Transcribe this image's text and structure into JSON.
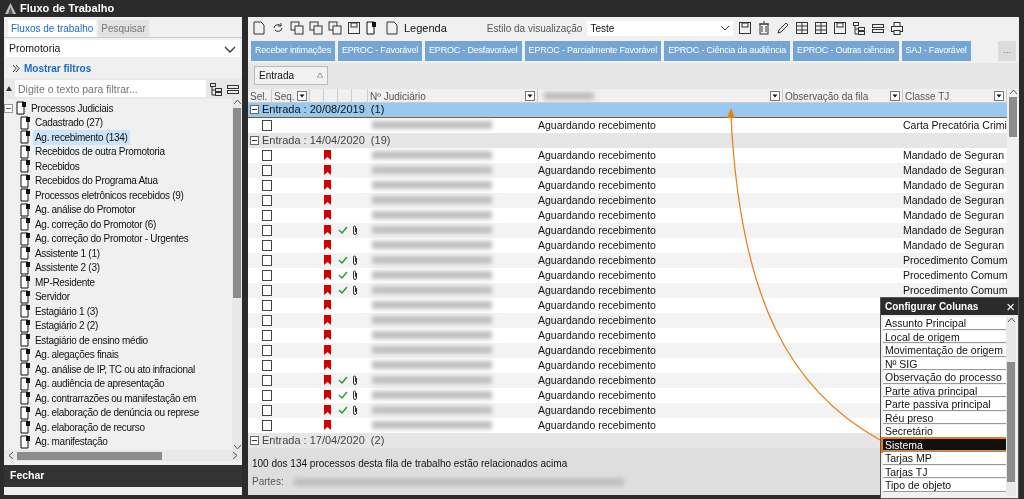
{
  "window": {
    "title": "Fluxo de Trabalho"
  },
  "sidebar": {
    "tabs": [
      {
        "label": "Fluxos de trabalho",
        "selected": true
      },
      {
        "label": "Pesquisar",
        "selected": false
      }
    ],
    "dropdown": {
      "value": "Promotoria"
    },
    "filters_link": "Mostrar filtros",
    "filter": {
      "placeholder": "Digite o texto para filtrar..."
    },
    "tree": [
      {
        "label": "Processos Judiciais",
        "expanded": true,
        "selected": false,
        "children": [
          {
            "label": "Cadastrado (27)",
            "selected": false
          },
          {
            "label": "Ag. recebimento (134)",
            "selected": true
          },
          {
            "label": "Recebidos de outra Promotoria",
            "selected": false
          },
          {
            "label": "Recebidos",
            "selected": false
          },
          {
            "label": "Recebidos do Programa Atua",
            "selected": false
          },
          {
            "label": "Processos eletrônicos recebidos (9)",
            "selected": false
          },
          {
            "label": "Ag. análise do Promotor",
            "selected": false
          },
          {
            "label": "Ag. correção do Promotor (6)",
            "selected": false
          },
          {
            "label": "Ag. correção do Promotor - Urgentes",
            "selected": false
          },
          {
            "label": "Assistente 1 (1)",
            "selected": false
          },
          {
            "label": "Assistente 2 (3)",
            "selected": false
          },
          {
            "label": "MP-Residente",
            "selected": false
          },
          {
            "label": "Servidor",
            "selected": false
          },
          {
            "label": "Estagiário 1 (3)",
            "selected": false
          },
          {
            "label": "Estagiário 2 (2)",
            "selected": false
          },
          {
            "label": "Estagiário de ensino médio",
            "selected": false
          },
          {
            "label": "Ag. alegações finais",
            "selected": false
          },
          {
            "label": "Ag. análise de IP, TC ou ato infracional",
            "selected": false
          },
          {
            "label": "Ag. audiência de apresentação",
            "selected": false
          },
          {
            "label": "Ag. contrarrazões ou manifestação em",
            "selected": false
          },
          {
            "label": "Ag. elaboração de denúncia ou represe",
            "selected": false
          },
          {
            "label": "Ag. elaboração de recurso",
            "selected": false
          },
          {
            "label": "Ag. manifestação",
            "selected": false
          }
        ]
      }
    ],
    "close_button": "Fechar"
  },
  "toolbar": {
    "legend": "Legenda",
    "view_style_label": "Estilo da visualização",
    "view_style": "Teste"
  },
  "action_buttons": [
    "Receber intimações",
    "EPROC - Favorável",
    "EPROC - Desfavorável",
    "EPROC - Parcialmente Favorável",
    "EPROC - Ciência da audiência",
    "EPROC - Outras ciências",
    "SAJ - Favorável"
  ],
  "more_button": "...",
  "group_by": {
    "label": "Entrada"
  },
  "table": {
    "columns": [
      "Sel.",
      "Seq.",
      "",
      "",
      "",
      "",
      "Nº Judiciário",
      "",
      "Observação da fila",
      "Classe TJ"
    ],
    "groups": [
      {
        "label": "Entrada : 20/08/2019",
        "count": "(1)",
        "expanded": true,
        "selected": true,
        "rows": [
          {
            "checked": false,
            "flag": false,
            "done": false,
            "attachment": false,
            "status": "Aguardando recebimento",
            "classe": "Carta Precatória Crimi"
          }
        ]
      },
      {
        "label": "Entrada : 14/04/2020",
        "count": "(19)",
        "expanded": true,
        "selected": false,
        "rows": [
          {
            "checked": false,
            "flag": true,
            "done": false,
            "attachment": false,
            "status": "Aguardando recebimento",
            "classe": "Mandado de Seguran"
          },
          {
            "checked": false,
            "flag": true,
            "done": false,
            "attachment": false,
            "status": "Aguardando recebimento",
            "classe": "Mandado de Seguran"
          },
          {
            "checked": false,
            "flag": true,
            "done": false,
            "attachment": false,
            "status": "Aguardando recebimento",
            "classe": "Mandado de Seguran"
          },
          {
            "checked": false,
            "flag": true,
            "done": false,
            "attachment": false,
            "status": "Aguardando recebimento",
            "classe": "Mandado de Seguran"
          },
          {
            "checked": false,
            "flag": true,
            "done": false,
            "attachment": false,
            "status": "Aguardando recebimento",
            "classe": "Mandado de Seguran"
          },
          {
            "checked": false,
            "flag": true,
            "done": true,
            "attachment": true,
            "status": "Aguardando recebimento",
            "classe": "Mandado de Seguran"
          },
          {
            "checked": false,
            "flag": true,
            "done": false,
            "attachment": false,
            "status": "Aguardando recebimento",
            "classe": "Mandado de Seguran"
          },
          {
            "checked": false,
            "flag": true,
            "done": true,
            "attachment": true,
            "status": "Aguardando recebimento",
            "classe": "Procedimento Comum"
          },
          {
            "checked": false,
            "flag": true,
            "done": true,
            "attachment": true,
            "status": "Aguardando recebimento",
            "classe": "Procedimento Comum"
          },
          {
            "checked": false,
            "flag": true,
            "done": true,
            "attachment": true,
            "status": "Aguardando recebimento",
            "classe": "Procedimento Comum"
          },
          {
            "checked": false,
            "flag": true,
            "done": false,
            "attachment": false,
            "status": "Aguardando recebimento"
          },
          {
            "checked": false,
            "flag": true,
            "done": false,
            "attachment": false,
            "status": "Aguardando recebimento"
          },
          {
            "checked": false,
            "flag": true,
            "done": false,
            "attachment": false,
            "status": "Aguardando recebimento"
          },
          {
            "checked": false,
            "flag": true,
            "done": false,
            "attachment": false,
            "status": "Aguardando recebimento"
          },
          {
            "checked": false,
            "flag": true,
            "done": false,
            "attachment": false,
            "status": "Aguardando recebimento"
          },
          {
            "checked": false,
            "flag": true,
            "done": true,
            "attachment": true,
            "status": "Aguardando recebimento"
          },
          {
            "checked": false,
            "flag": true,
            "done": true,
            "attachment": true,
            "status": "Aguardando recebimento"
          },
          {
            "checked": false,
            "flag": true,
            "done": true,
            "attachment": true,
            "status": "Aguardando recebimento"
          },
          {
            "checked": false,
            "flag": true,
            "done": false,
            "attachment": false,
            "status": "Aguardando recebimento"
          }
        ]
      },
      {
        "label": "Entrada : 17/04/2020",
        "count": "(2)",
        "expanded": true,
        "selected": false
      }
    ]
  },
  "summary": "100 dos 134 processos desta fila de trabalho estão relacionados acima",
  "parties_label": "Partes:",
  "column_config": {
    "title": "Configurar Colunas",
    "close": "×",
    "items": [
      {
        "label": "Assunto Principal",
        "selected": false
      },
      {
        "label": "Local de origem",
        "selected": false
      },
      {
        "label": "Movimentação de origem",
        "selected": false
      },
      {
        "label": "Nº SIG",
        "selected": false
      },
      {
        "label": "Observação do processo",
        "selected": false
      },
      {
        "label": "Parte ativa principal",
        "selected": false
      },
      {
        "label": "Parte passiva principal",
        "selected": false
      },
      {
        "label": "Réu preso",
        "selected": false
      },
      {
        "label": "Secretário",
        "selected": false
      },
      {
        "label": "Sistema",
        "selected": true
      },
      {
        "label": "Tarjas MP",
        "selected": false
      },
      {
        "label": "Tarjas TJ",
        "selected": false
      },
      {
        "label": "Tipo de objeto",
        "selected": false
      }
    ]
  }
}
